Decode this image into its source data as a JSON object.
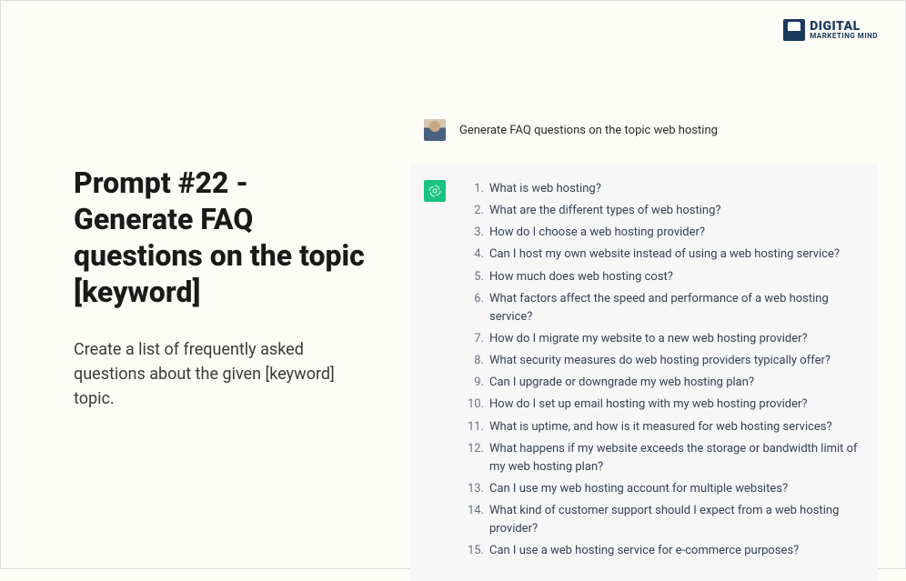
{
  "logo": {
    "top": "DIGITAL",
    "bottom": "MARKETING MIND"
  },
  "left": {
    "heading": "Prompt #22 - Generate FAQ questions on the topic [keyword]",
    "description": "Create a list of frequently asked questions about the given [keyword] topic."
  },
  "chat": {
    "user_message": "Generate FAQ questions on the topic web hosting",
    "faqs": [
      "What is web hosting?",
      "What are the different types of web hosting?",
      "How do I choose a web hosting provider?",
      "Can I host my own website instead of using a web hosting service?",
      "How much does web hosting cost?",
      "What factors affect the speed and performance of a web hosting service?",
      "How do I migrate my website to a new web hosting provider?",
      "What security measures do web hosting providers typically offer?",
      "Can I upgrade or downgrade my web hosting plan?",
      "How do I set up email hosting with my web hosting provider?",
      "What is uptime, and how is it measured for web hosting services?",
      "What happens if my website exceeds the storage or bandwidth limit of my web hosting plan?",
      "Can I use my web hosting account for multiple websites?",
      "What kind of customer support should I expect from a web hosting provider?",
      "Can I use a web hosting service for e-commerce purposes?"
    ]
  }
}
